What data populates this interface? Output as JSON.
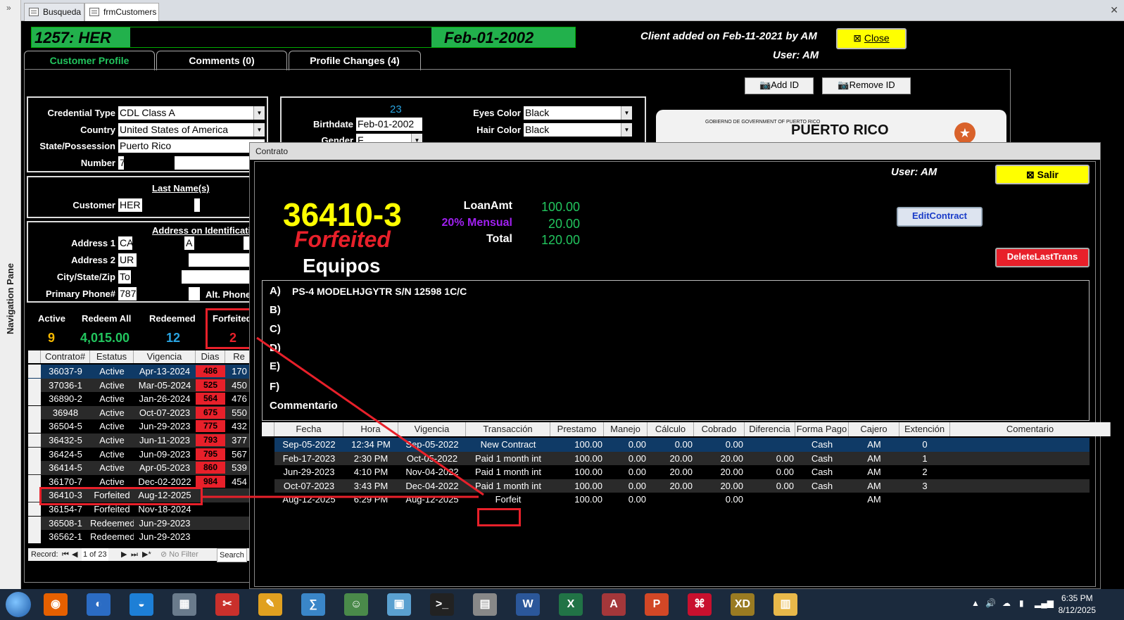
{
  "doc_tabs": [
    {
      "label": "Busqueda",
      "active": false
    },
    {
      "label": "frmCustomers",
      "active": true
    }
  ],
  "nav_pane": {
    "label": "Navigation Pane"
  },
  "header": {
    "customer_id": "1257:  HER",
    "dob": "Feb-01-2002",
    "added": "Client added on Feb-11-2021 by AM",
    "user": "User: AM",
    "close_label": "Close"
  },
  "form_tabs": [
    "Customer Profile",
    "Comments (0)",
    "Profile Changes (4)"
  ],
  "credential": {
    "type_label": "Credential Type",
    "type_value": "CDL Class A",
    "country_label": "Country",
    "country_value": "United States of America",
    "state_label": "State/Possession",
    "state_value": "Puerto Rico",
    "number_label": "Number",
    "number_value": "7"
  },
  "physical": {
    "age": "23",
    "birthdate_label": "Birthdate",
    "birthdate_value": "Feb-01-2002",
    "gender_label": "Gender",
    "gender_value": "F",
    "eyes_label": "Eyes Color",
    "eyes_value": "Black",
    "hair_label": "Hair Color",
    "hair_value": "Black"
  },
  "id_buttons": {
    "add": "Add ID",
    "remove": "Remove ID"
  },
  "id_photo": {
    "title": "PUERTO RICO",
    "gov": "GOBIERNO DE\nGOVERNMENT OF PUERTO RICO"
  },
  "name": {
    "last_names_label": "Last Name(s)",
    "customer_label": "Customer",
    "customer_value": "HER"
  },
  "address": {
    "section_label": "Address on Identificatio",
    "address1_label": "Address 1",
    "address1_value": "CA",
    "address1_b": "A",
    "address2_label": "Address 2",
    "address2_value": "UR",
    "city_label": "City/State/Zip",
    "city_value": "To",
    "phone_label": "Primary Phone#",
    "phone_value": "787",
    "alt_phone_label": "Alt. Phone"
  },
  "stats": [
    {
      "label": "Active",
      "value": "9",
      "color": "#f5b800"
    },
    {
      "label": "Redeem All",
      "value": "4,015.00",
      "color": "#22c55e"
    },
    {
      "label": "Redeemed",
      "value": "12",
      "color": "#29a3e0"
    },
    {
      "label": "Forfeited",
      "value": "2",
      "color": "#e8202a"
    }
  ],
  "left_grid": {
    "headers": [
      "Contrato#",
      "Estatus",
      "Vigencia",
      "Dias",
      "Re"
    ],
    "rows": [
      {
        "contrato": "36037-9",
        "estatus": "Active",
        "vigencia": "Apr-13-2024",
        "dias": "486",
        "re": "170"
      },
      {
        "contrato": "37036-1",
        "estatus": "Active",
        "vigencia": "Mar-05-2024",
        "dias": "525",
        "re": "450"
      },
      {
        "contrato": "36890-2",
        "estatus": "Active",
        "vigencia": "Jan-26-2024",
        "dias": "564",
        "re": "476"
      },
      {
        "contrato": "36948",
        "estatus": "Active",
        "vigencia": "Oct-07-2023",
        "dias": "675",
        "re": "550"
      },
      {
        "contrato": "36504-5",
        "estatus": "Active",
        "vigencia": "Jun-29-2023",
        "dias": "775",
        "re": "432"
      },
      {
        "contrato": "36432-5",
        "estatus": "Active",
        "vigencia": "Jun-11-2023",
        "dias": "793",
        "re": "377"
      },
      {
        "contrato": "36424-5",
        "estatus": "Active",
        "vigencia": "Jun-09-2023",
        "dias": "795",
        "re": "567"
      },
      {
        "contrato": "36414-5",
        "estatus": "Active",
        "vigencia": "Apr-05-2023",
        "dias": "860",
        "re": "539"
      },
      {
        "contrato": "36170-7",
        "estatus": "Active",
        "vigencia": "Dec-02-2022",
        "dias": "984",
        "re": "454"
      },
      {
        "contrato": "36410-3",
        "estatus": "Forfeited",
        "vigencia": "Aug-12-2025",
        "dias": "",
        "re": ""
      },
      {
        "contrato": "36154-7",
        "estatus": "Forfeited",
        "vigencia": "Nov-18-2024",
        "dias": "",
        "re": ""
      },
      {
        "contrato": "36508-1",
        "estatus": "Redeemed",
        "vigencia": "Jun-29-2023",
        "dias": "",
        "re": ""
      },
      {
        "contrato": "36562-1",
        "estatus": "Redeemed",
        "vigencia": "Jun-29-2023",
        "dias": "",
        "re": ""
      }
    ],
    "record_label": "Record:",
    "record_pos": "1 of 23",
    "no_filter": "No Filter",
    "search": "Search"
  },
  "contrato": {
    "window_title": "Contrato",
    "user": "User: AM",
    "salir": "Salir",
    "number": "36410-3",
    "status": "Forfeited",
    "category": "Equipos",
    "loan_label": "LoanAmt",
    "loan_value": "100.00",
    "interest_label": "20% Mensual",
    "interest_value": "20.00",
    "total_label": "Total",
    "total_value": "120.00",
    "edit_label": "EditContract",
    "delete_label": "DeleteLastTrans",
    "items": [
      {
        "letter": "A)",
        "text": "PS-4 MODELHJGYTR S/N 12598 1C/C"
      },
      {
        "letter": "B)",
        "text": ""
      },
      {
        "letter": "C)",
        "text": ""
      },
      {
        "letter": "D)",
        "text": ""
      },
      {
        "letter": "E)",
        "text": ""
      },
      {
        "letter": "F)",
        "text": ""
      }
    ],
    "comment_label": "Commentario",
    "grid_headers": [
      "Fecha",
      "Hora",
      "Vigencia",
      "Transacción",
      "Prestamo",
      "Manejo",
      "Cálculo",
      "Cobrado",
      "Diferencia",
      "Forma Pago",
      "Cajero",
      "Extención",
      "Comentario"
    ],
    "transactions": [
      {
        "fecha": "Sep-05-2022",
        "hora": "12:34 PM",
        "vigencia": "Sep-05-2022",
        "trans": "New Contract",
        "prestamo": "100.00",
        "manejo": "0.00",
        "calculo": "0.00",
        "cobrado": "0.00",
        "diferencia": "",
        "forma": "Cash",
        "cajero": "AM",
        "ext": "0"
      },
      {
        "fecha": "Feb-17-2023",
        "hora": "2:30 PM",
        "vigencia": "Oct-05-2022",
        "trans": "Paid 1 month int",
        "prestamo": "100.00",
        "manejo": "0.00",
        "calculo": "20.00",
        "cobrado": "20.00",
        "diferencia": "0.00",
        "forma": "Cash",
        "cajero": "AM",
        "ext": "1"
      },
      {
        "fecha": "Jun-29-2023",
        "hora": "4:10 PM",
        "vigencia": "Nov-04-2022",
        "trans": "Paid 1 month int",
        "prestamo": "100.00",
        "manejo": "0.00",
        "calculo": "20.00",
        "cobrado": "20.00",
        "diferencia": "0.00",
        "forma": "Cash",
        "cajero": "AM",
        "ext": "2"
      },
      {
        "fecha": "Oct-07-2023",
        "hora": "3:43 PM",
        "vigencia": "Dec-04-2022",
        "trans": "Paid 1 month int",
        "prestamo": "100.00",
        "manejo": "0.00",
        "calculo": "20.00",
        "cobrado": "20.00",
        "diferencia": "0.00",
        "forma": "Cash",
        "cajero": "AM",
        "ext": "3"
      },
      {
        "fecha": "Aug-12-2025",
        "hora": "6:29 PM",
        "vigencia": "Aug-12-2025",
        "trans": "Forfeit",
        "prestamo": "100.00",
        "manejo": "0.00",
        "calculo": "",
        "cobrado": "0.00",
        "diferencia": "",
        "forma": "",
        "cajero": "AM",
        "ext": ""
      }
    ]
  },
  "taskbar": {
    "apps": [
      "firefox-icon",
      "thunderbird-icon",
      "browser-icon",
      "network-icon",
      "tools-icon",
      "paint-icon",
      "math-icon",
      "user-icon",
      "screen-icon",
      "terminal-icon",
      "scanner-icon",
      "word-icon",
      "excel-icon",
      "access-icon",
      "powerpoint-icon",
      "acrobat-icon",
      "xd-icon",
      "explorer-icon"
    ],
    "time": "6:35 PM",
    "date": "8/12/2025"
  },
  "colors": {
    "title_green": "#22b14c",
    "yellow": "#ffff00",
    "forfeit_red": "#e8202a",
    "amount_green": "#22c55e",
    "selected_row": "#0f3a66"
  }
}
